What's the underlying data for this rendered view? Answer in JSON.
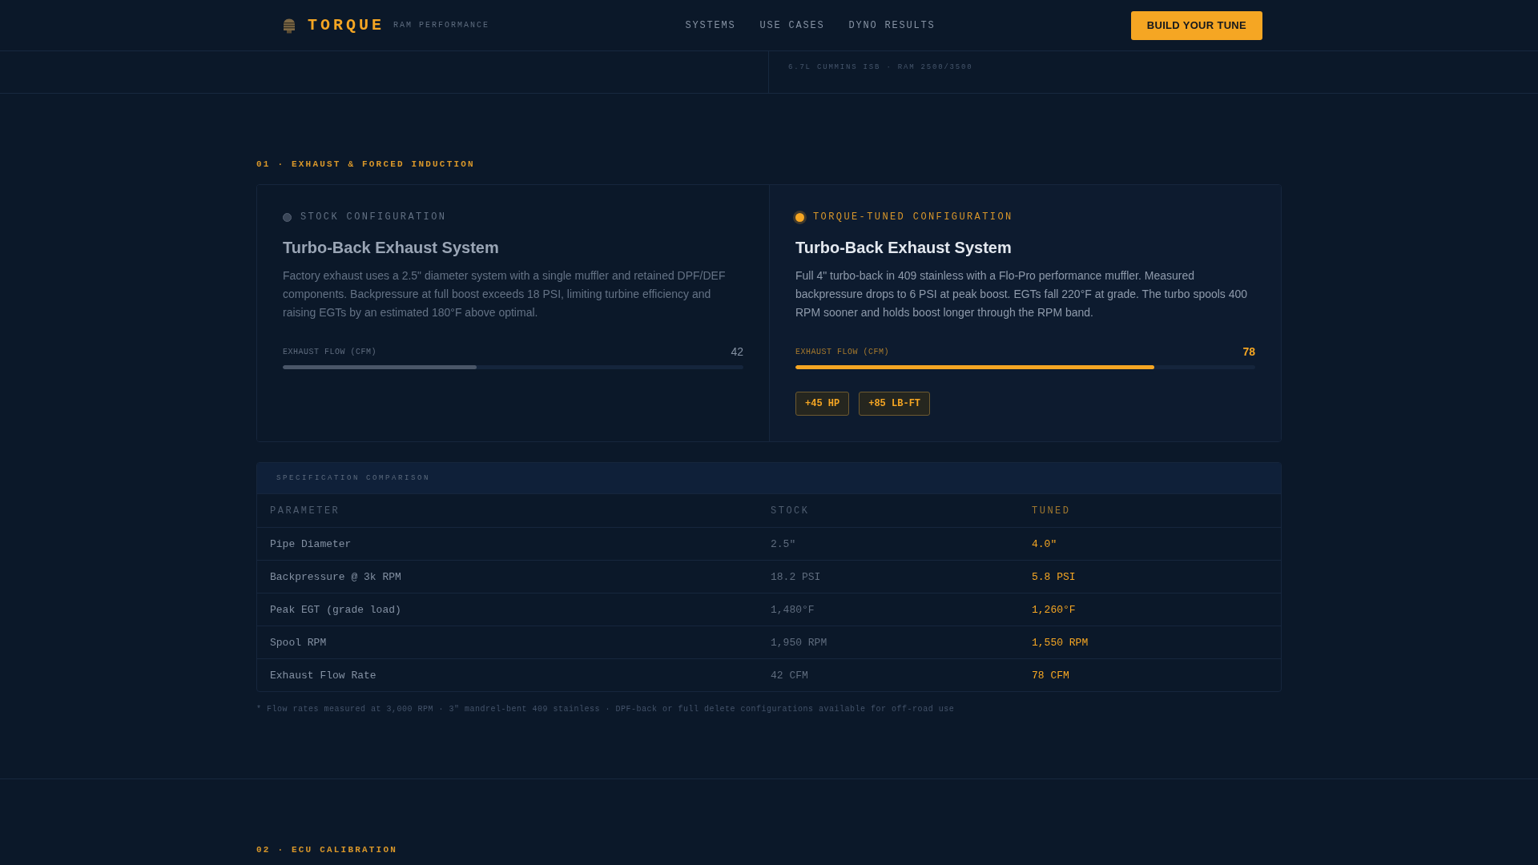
{
  "header": {
    "brand": {
      "name": "TORQUE",
      "tagline": "RAM PERFORMANCE"
    },
    "nav": [
      {
        "label": "SYSTEMS"
      },
      {
        "label": "USE CASES"
      },
      {
        "label": "DYNO RESULTS"
      }
    ],
    "cta": "BUILD YOUR TUNE"
  },
  "subheader": {
    "vehicle": "6.7L CUMMINS ISB · RAM 2500/3500"
  },
  "sections": [
    {
      "label": "01 · EXHAUST & FORCED INDUCTION",
      "comparison": [
        {
          "kind": "stock",
          "tag": "STOCK CONFIGURATION",
          "title": "Turbo-Back Exhaust System",
          "description": "Factory exhaust uses a 2.5\" diameter system with a single muffler and retained DPF/DEF components. Backpressure at full boost exceeds 18 PSI, limiting turbine efficiency and raising EGTs by an estimated 180°F above optimal.",
          "metric": {
            "label": "EXHAUST FLOW (CFM)",
            "reading": "42",
            "level": 0.42
          }
        },
        {
          "kind": "tuned",
          "tag": "TORQUE-TUNED CONFIGURATION",
          "title": "Turbo-Back Exhaust System",
          "description": "Full 4\" turbo-back in 409 stainless with a Flo-Pro performance muffler. Measured backpressure drops to 6 PSI at peak boost. EGTs fall 220°F at grade. The turbo spools 400 RPM sooner and holds boost longer through the RPM band.",
          "metric": {
            "label": "EXHAUST FLOW (CFM)",
            "reading": "78",
            "level": 0.78
          },
          "gains": [
            "+45 HP",
            "+85 LB-FT"
          ]
        }
      ],
      "spec_table": {
        "title": "SPECIFICATION COMPARISON",
        "columns": [
          {
            "label": "PARAMETER",
            "kind": "parameter"
          },
          {
            "label": "STOCK",
            "kind": "stock"
          },
          {
            "label": "TUNED",
            "kind": "tuned"
          }
        ],
        "rows": [
          [
            "Pipe Diameter",
            "2.5\"",
            "4.0\""
          ],
          [
            "Backpressure @ 3k RPM",
            "18.2 PSI",
            "5.8 PSI"
          ],
          [
            "Peak EGT (grade load)",
            "1,480°F",
            "1,260°F"
          ],
          [
            "Spool RPM",
            "1,950 RPM",
            "1,550 RPM"
          ],
          [
            "Exhaust Flow Rate",
            "42 CFM",
            "78 CFM"
          ]
        ]
      },
      "footnote": "* Flow rates measured at 3,000 RPM · 3\" mandrel-bent 409 stainless · DPF-back or full delete configurations available for off-road use"
    },
    {
      "label": "02 · ECU CALIBRATION"
    }
  ]
}
